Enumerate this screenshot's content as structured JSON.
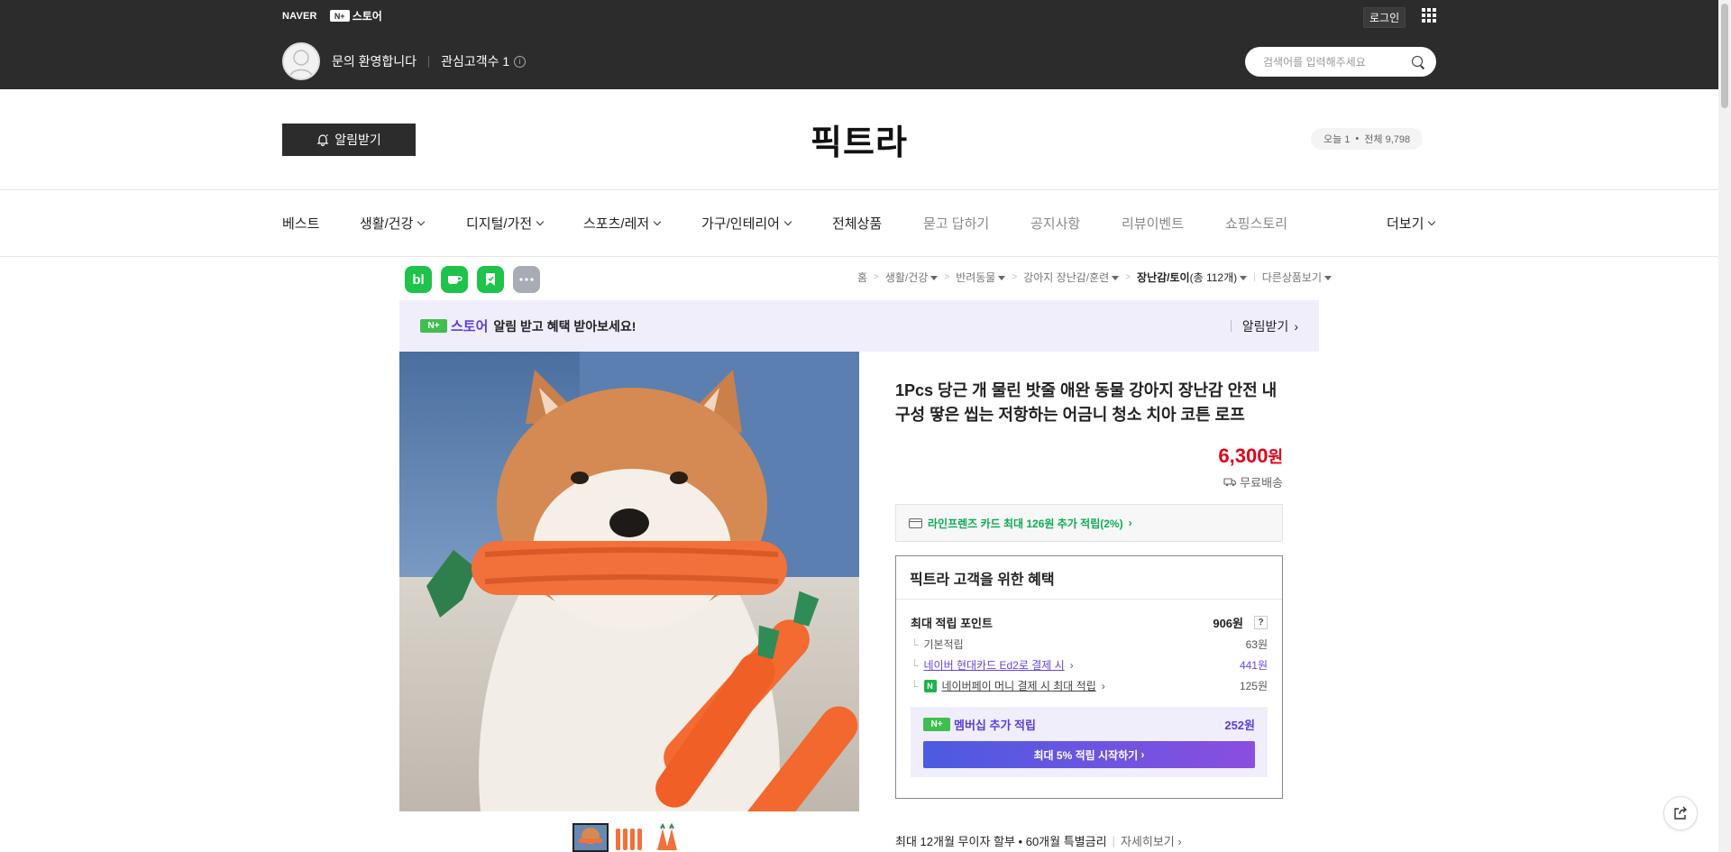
{
  "topbar": {
    "naver_logo": "NAVER",
    "store_logo_badge": "N+",
    "store_logo_text": "스토어",
    "login_label": "로그인",
    "welcome_text": "문의 환영합니다",
    "interest_text": "관심고객수 1",
    "search_placeholder": "검색어를 입력해주세요"
  },
  "store": {
    "alarm_button": "알림받기",
    "title": "픽트라",
    "visitors_today": "오늘 1",
    "visitors_total": "전체 9,798"
  },
  "nav": {
    "items": [
      {
        "label": "베스트"
      },
      {
        "label": "생활/건강"
      },
      {
        "label": "디지털/가전"
      },
      {
        "label": "스포츠/레저"
      },
      {
        "label": "가구/인테리어"
      },
      {
        "label": "전체상품"
      },
      {
        "label": "묻고 답하기"
      },
      {
        "label": "공지사항"
      },
      {
        "label": "리뷰이벤트"
      },
      {
        "label": "쇼핑스토리"
      }
    ],
    "more": "더보기"
  },
  "side_icons": [
    "bl",
    "talk-icon",
    "bookmark-icon",
    "more-icon"
  ],
  "breadcrumb": {
    "home": "홈",
    "c1": "생활/건강",
    "c2": "반려동물",
    "c3": "강아지 장난감/훈련",
    "c4_name": "장난감/토이",
    "c4_count": "(총 112개)",
    "other": "다른상품보기"
  },
  "banner": {
    "badge": "N+",
    "store": "스토어",
    "text": "알림 받고 혜택 받아보세요!",
    "link": "알림받기"
  },
  "product": {
    "name": "1Pcs 당근 개 물린 밧줄 애완 동물 강아지 장난감 안전 내구성 땋은 씹는 저항하는 어금니 청소 치아 코튼 로프",
    "price": "6,300",
    "price_unit": "원",
    "shipping": "무료배송",
    "card_benefit": "라인프렌즈 카드 최대 126원 추가 적립(2%)"
  },
  "benefit": {
    "title": "픽트라 고객을 위한 혜택",
    "max_point_label": "최대 적립 포인트",
    "max_point_value": "906원",
    "qmark": "?",
    "base_label": "기본적립",
    "base_value": "63원",
    "card_label": "네이버 현대카드 Ed2로 결제 시",
    "card_value": "441원",
    "npay_label": "네이버페이 머니 결제 시 최대 적립",
    "npay_value": "125원",
    "membership_label": "멤버십 추가 적립",
    "membership_value": "252원",
    "membership_badge": "N+",
    "membership_button": "최대 5% 적립 시작하기"
  },
  "installment": {
    "text": "최대 12개월 무이자 할부 • 60개월 특별금리",
    "more": "자세히보기"
  }
}
